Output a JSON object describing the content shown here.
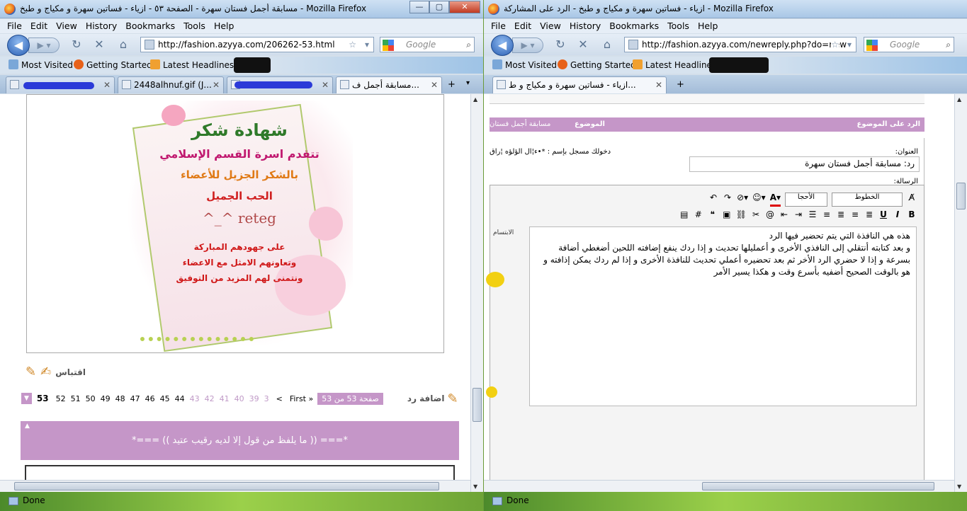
{
  "window1": {
    "title": "مسابقة أجمل فستان سهرة - الصفحة ٥٣ - ازياء - فساتين سهرة و مكياج و طبخ - Mozilla Firefox",
    "menu": [
      "File",
      "Edit",
      "View",
      "History",
      "Bookmarks",
      "Tools",
      "Help"
    ],
    "url": "http://fashion.azyya.com/206262-53.html",
    "search_placeholder": "Google",
    "bookmarks": [
      "Most Visited",
      "Getting Started",
      "Latest Headlines"
    ],
    "tabs": [
      "2448alhnuf.gif (J...",
      "مسابقة أجمل ف..."
    ],
    "certificate": {
      "line1": "شهادة شكر",
      "line2": "تتقدم اسرة القسم الإسلامي",
      "line3": "بالشكر الجزيل للأعضاء",
      "line4": "الحب الجميل",
      "line5": "reteg ^_^",
      "line6": "على جهودهم المباركة",
      "line7": "وتعاونهم الامثل مع الاعضاء",
      "line8": "ونتمنى لهم المزيد من التوفيق"
    },
    "quote_label": "اقتباس",
    "reply_label": "اضافة رد",
    "page_label": "صفحة 53 من 53",
    "first_label": "First »",
    "pages_dim": [
      "3",
      "39",
      "40",
      "41",
      "42",
      "43"
    ],
    "pages": [
      "44",
      "45",
      "46",
      "47",
      "48",
      "49",
      "50",
      "51",
      "52"
    ],
    "current_page": "53",
    "prev_arrow": "<",
    "signature": "*=== (( ما يلفظ من قول إلا لديه رقيب عتيد )) ===*",
    "status": "Done"
  },
  "window2": {
    "title": "ازياء - فساتين سهرة و مكياج و طبخ - الرد على المشاركة - Mozilla Firefox",
    "menu": [
      "File",
      "Edit",
      "View",
      "History",
      "Bookmarks",
      "Tools",
      "Help"
    ],
    "url": "http://fashion.azyya.com/newreply.php?do=new",
    "search_placeholder": "Google",
    "bookmarks": [
      "Most Visited",
      "Getting Started",
      "Latest Headlines"
    ],
    "tabs": [
      "ازياء - فساتين سهرة و مكياج و ط..."
    ],
    "header_reply": "الرد على الموضوع",
    "header_topic": "الموضوع",
    "header_topic_value": "مسابقة أجمل فستان",
    "title_label": "العنوان:",
    "title_value": "رد: مسابقة أجمل فستان سهرة",
    "logged_in": "دخولك مسجل بإسم : *•ء¦ال الؤلؤه ¦راق",
    "message_label": "الرسالة:",
    "font_label": "الخطوط",
    "size_label": "الأحجا",
    "smilies_label": "الابتسام",
    "message_text": "هذه هي النافذة التي يتم تحضير فيها الرد\nو بعد كتابته أنتقلي إلى النافذي الأخرى و أعمليلها تحديث و إذا ردك ينفع إضافته اللحين أضغطي أضافة بسرعة و إذا لا حضري الرد الأخر ثم بعد تحضيره أعملي تحديث للنافذة الأخرى و إذا لم ردك يمكن إذافته و هو بالوقت الصحيح أضفيه بأسرع وقت و هكذا يسير الأمر",
    "status": "Done"
  },
  "colors": {
    "accent": "#c596c8",
    "status": "#6ea436"
  }
}
